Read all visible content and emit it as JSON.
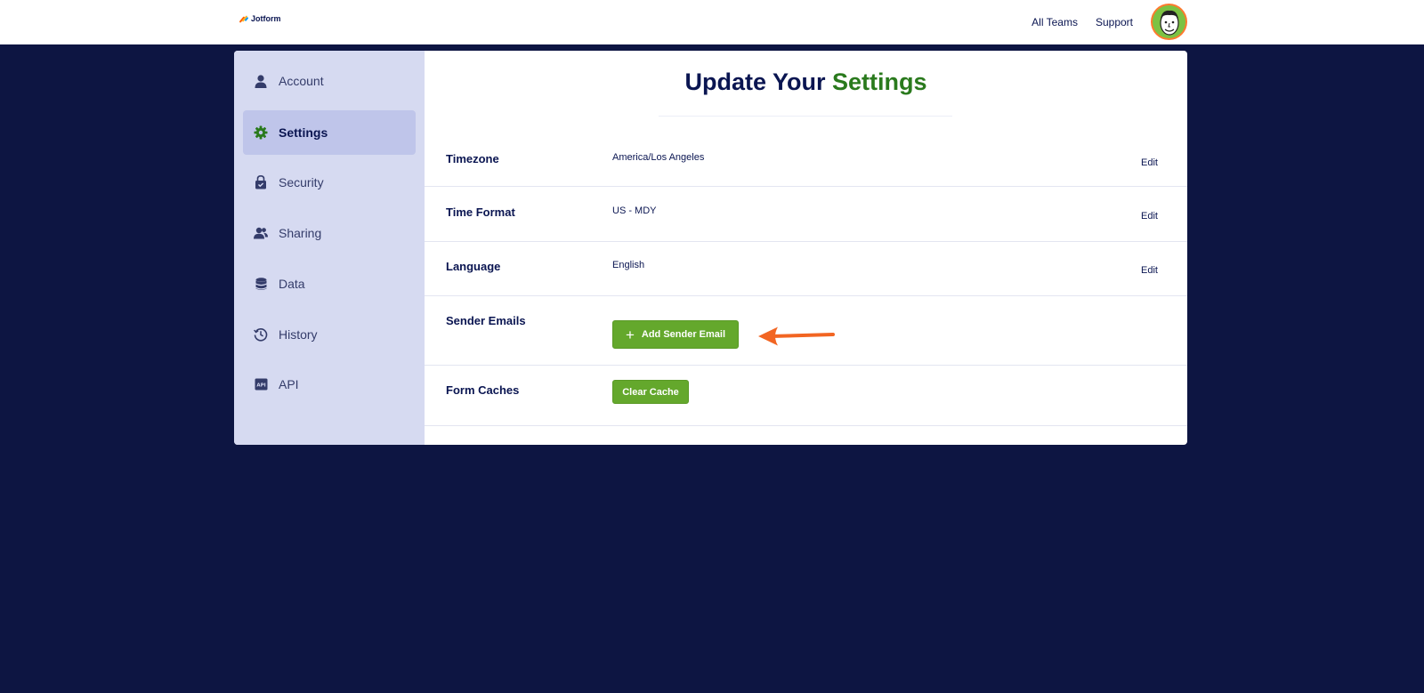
{
  "header": {
    "logo_text": "Jotform",
    "links": [
      "All Teams",
      "Support"
    ],
    "avatar_icon": "user-avatar-icon"
  },
  "sidebar": {
    "items": [
      {
        "label": "Account",
        "icon": "person-icon",
        "active": false
      },
      {
        "label": "Settings",
        "icon": "gear-icon",
        "active": true
      },
      {
        "label": "Security",
        "icon": "lock-shield-icon",
        "active": false
      },
      {
        "label": "Sharing",
        "icon": "people-icon",
        "active": false
      },
      {
        "label": "Data",
        "icon": "database-icon",
        "active": false
      },
      {
        "label": "History",
        "icon": "history-clock-icon",
        "active": false
      },
      {
        "label": "API",
        "icon": "api-icon",
        "active": false
      }
    ]
  },
  "main": {
    "title_prefix": "Update Your ",
    "title_accent": "Settings",
    "rows": {
      "timezone": {
        "label": "Timezone",
        "value": "America/Los Angeles",
        "edit": "Edit"
      },
      "time_format": {
        "label": "Time Format",
        "value": "US - MDY",
        "edit": "Edit"
      },
      "language": {
        "label": "Language",
        "value": "English",
        "edit": "Edit"
      },
      "sender_emails": {
        "label": "Sender Emails",
        "button": "Add Sender Email"
      },
      "form_caches": {
        "label": "Form Caches",
        "button": "Clear Cache"
      }
    }
  },
  "colors": {
    "background": "#0d1542",
    "sidebar": "#d6daf1",
    "sidebar_active": "#bfc5ea",
    "accent_green": "#2a7a1d",
    "button_green": "#64a82c",
    "arrow_orange": "#f26522",
    "text_navy": "#0a1551"
  }
}
